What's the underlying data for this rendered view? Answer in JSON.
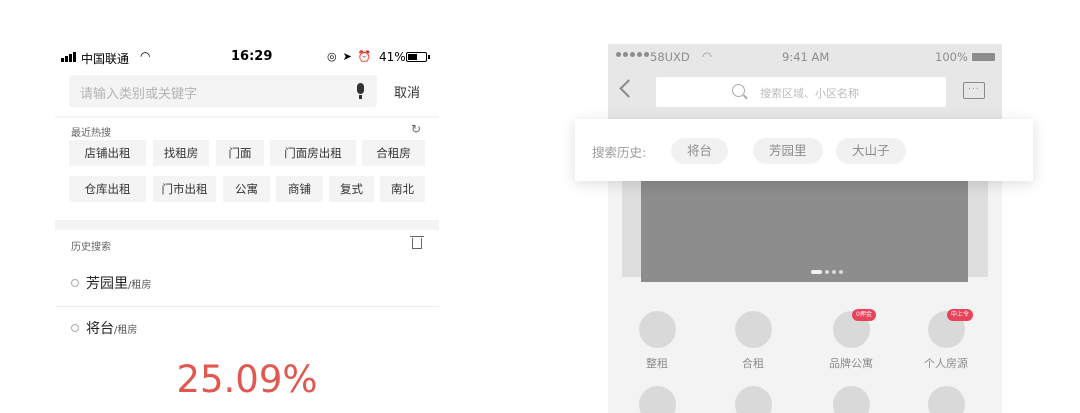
{
  "left_phone": {
    "status": {
      "carrier": "中国联通",
      "time": "16:29",
      "battery_pct": "41%"
    },
    "search": {
      "placeholder": "请输入类别或关键字",
      "cancel_label": "取消"
    },
    "hot": {
      "title": "最近热搜",
      "tags": [
        "店铺出租",
        "找租房",
        "门面",
        "门面房出租",
        "合租房",
        "仓库出租",
        "门市出租",
        "公寓",
        "商铺",
        "复式",
        "南北"
      ]
    },
    "history": {
      "title": "历史搜索",
      "items": [
        {
          "name": "芳园里",
          "suffix": "/租房"
        },
        {
          "name": "将台",
          "suffix": "/租房"
        }
      ]
    },
    "overlay_percent": "25.09%"
  },
  "right_phone": {
    "status": {
      "carrier": "58UXD",
      "time": "9:41 AM",
      "battery_pct": "100%"
    },
    "search": {
      "placeholder": "搜索区域、小区名称"
    },
    "entries": [
      {
        "label": "整租",
        "badge": ""
      },
      {
        "label": "合租",
        "badge": ""
      },
      {
        "label": "品牌公寓",
        "badge": "0押金"
      },
      {
        "label": "个人房源",
        "badge": "中上令"
      }
    ]
  },
  "history_card": {
    "label": "搜索历史:",
    "chips": [
      "将台",
      "芳园里",
      "大山子"
    ]
  },
  "colors": {
    "accent_red": "#e05850",
    "badge_pink": "#e8435a"
  }
}
